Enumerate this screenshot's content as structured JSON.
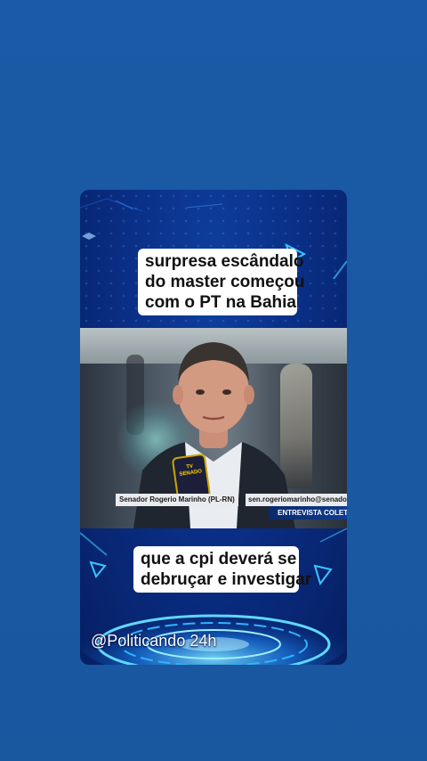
{
  "caption_top": {
    "lines": [
      "surpresa escândalo",
      "do master começou",
      "com o PT na Bahia"
    ]
  },
  "caption_bottom": {
    "lines": [
      "que a cpi deverá se",
      "debruçar e investigar"
    ]
  },
  "video": {
    "lower_third_name": "Senador Rogerio Marinho (PL-RN)",
    "email": "sen.rogeriomarinho@senado",
    "tag": "ENTREVISTA COLET",
    "mic_label": [
      "TV",
      "SENADO"
    ]
  },
  "watermark": {
    "handle": "@Politicando 24h"
  },
  "colors": {
    "background": "#1a5aa6",
    "card_bg": "#0a2f86",
    "caption_bg": "#ffffff",
    "accent_cyan": "#39c6ff"
  }
}
